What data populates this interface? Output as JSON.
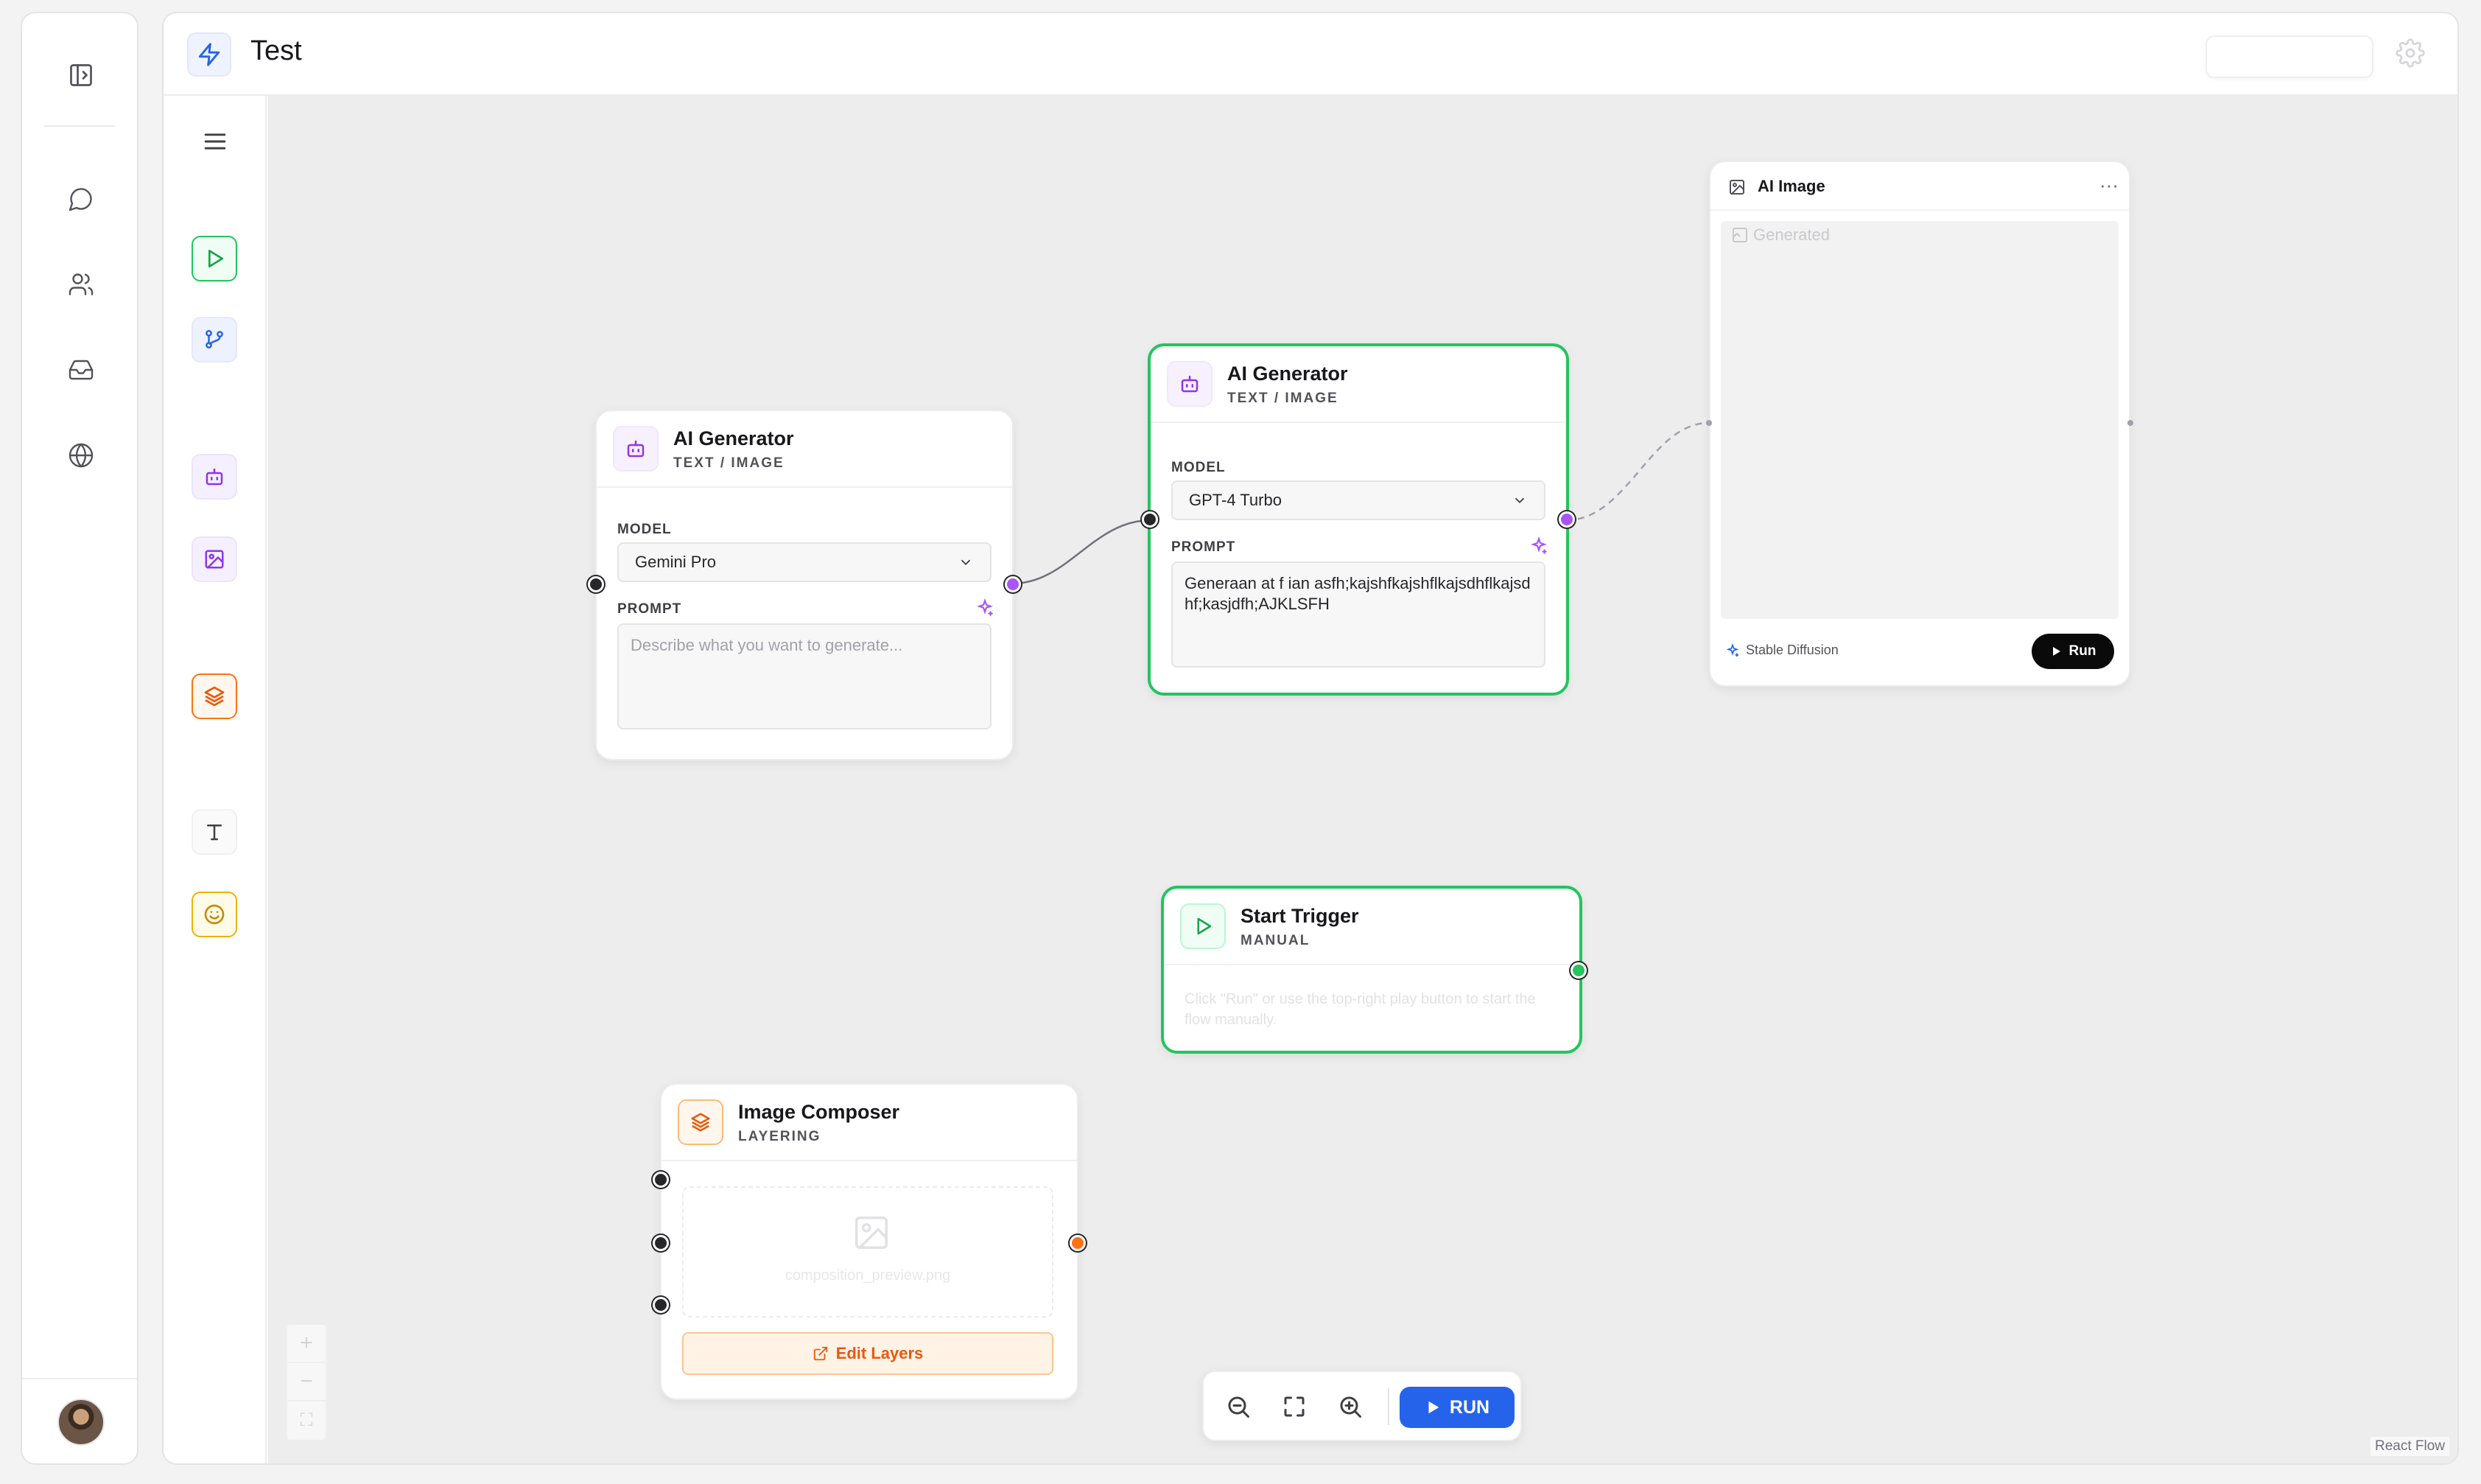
{
  "rail": {
    "icons": [
      "sidebar-toggle-icon",
      "chat-icon",
      "users-icon",
      "inbox-icon",
      "globe-icon"
    ]
  },
  "header": {
    "title": "Test"
  },
  "palette": {
    "tools": [
      "start-trigger",
      "branch",
      "ai-generator",
      "ai-image",
      "image-composer",
      "text",
      "emoji"
    ]
  },
  "nodes": {
    "gen1": {
      "title": "AI Generator",
      "subtitle": "TEXT / IMAGE",
      "model_label": "MODEL",
      "model_value": "Gemini Pro",
      "prompt_label": "PROMPT",
      "prompt_placeholder": "Describe what you want to generate...",
      "prompt_value": ""
    },
    "gen2": {
      "title": "AI Generator",
      "subtitle": "TEXT / IMAGE",
      "model_label": "MODEL",
      "model_value": "GPT-4 Turbo",
      "prompt_label": "PROMPT",
      "prompt_value": "Generaan at f ian asfh;kajshfkajshflkajsdhflkajsdhf;kasjdfh;AJKLSFH"
    },
    "ai_image": {
      "title": "AI Image",
      "image_alt": "Generated",
      "provider": "Stable Diffusion",
      "run_label": "Run"
    },
    "trigger": {
      "title": "Start Trigger",
      "subtitle": "MANUAL",
      "description": "Click \"Run\" or use the top-right play button to start the flow manually."
    },
    "composer": {
      "title": "Image Composer",
      "subtitle": "LAYERING",
      "preview_file": "composition_preview.png",
      "edit_label": "Edit Layers"
    }
  },
  "canvas_controls": {
    "zoom_in": "+",
    "zoom_out": "−",
    "fit": "⛶"
  },
  "toolbar": {
    "run_label": "RUN"
  },
  "attribution": "React Flow",
  "colors": {
    "accent_blue": "#2563eb",
    "selected_green": "#22c55e",
    "purple": "#a855f7",
    "orange": "#f97316"
  }
}
